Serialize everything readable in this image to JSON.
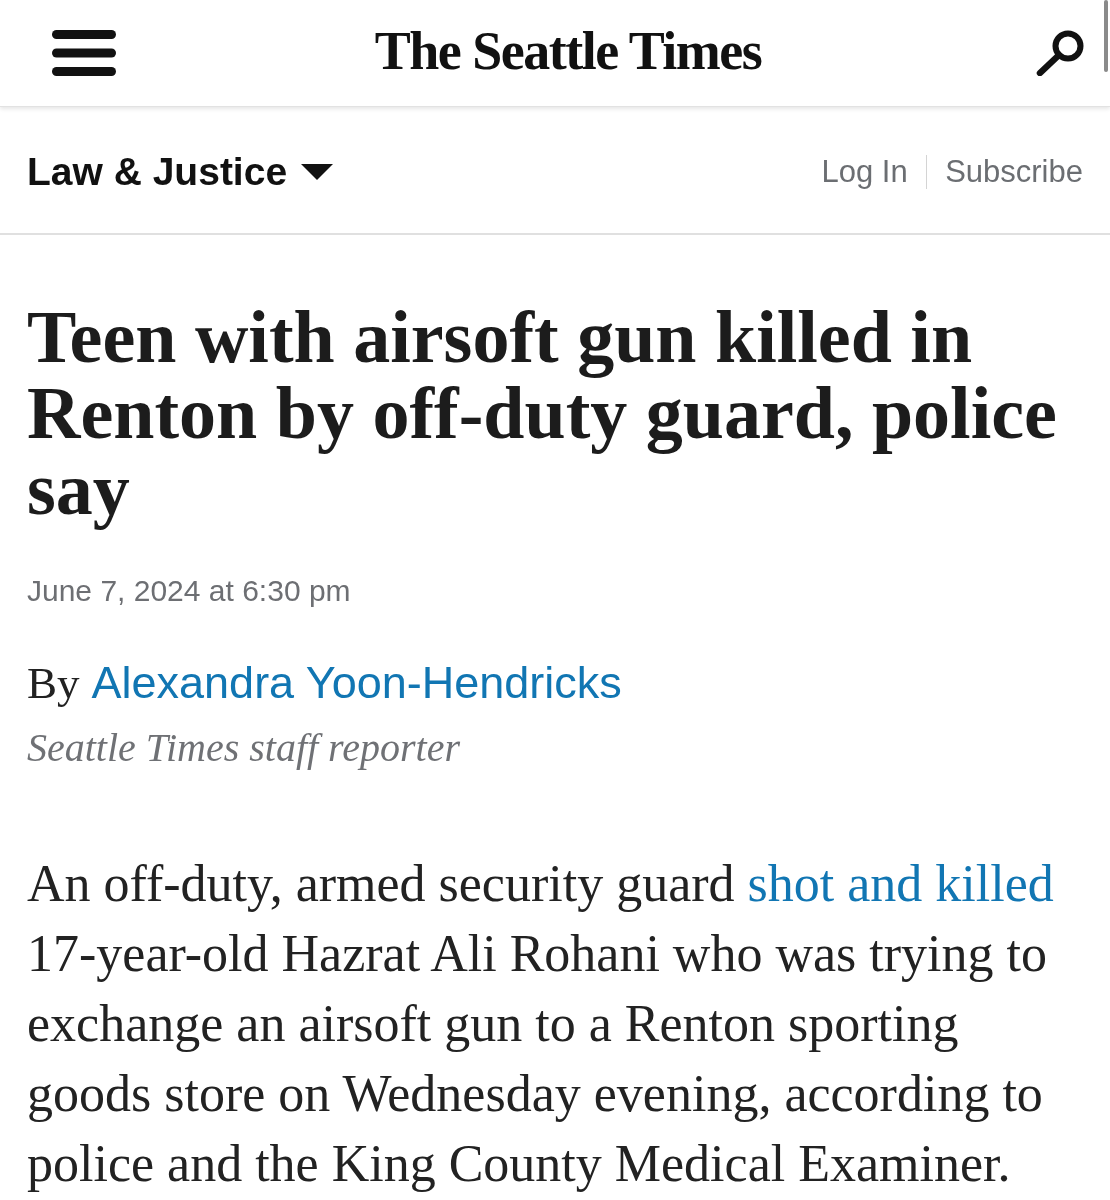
{
  "header": {
    "logo": "The Seattle Times"
  },
  "section_bar": {
    "section": "Law & Justice",
    "links": [
      "Log In",
      "Subscribe"
    ]
  },
  "article": {
    "headline": "Teen with airsoft gun killed in Renton by off-duty guard, police say",
    "timestamp": "June 7, 2024 at 6:30 pm",
    "byline": {
      "prefix": "By",
      "author": "Alexandra Yoon-Hendricks",
      "role": "Seattle Times staff reporter"
    },
    "paragraphs": [
      {
        "segments": [
          {
            "kind": "text",
            "text": "An off-duty, armed security guard "
          },
          {
            "kind": "link",
            "text": "shot and killed"
          },
          {
            "kind": "text",
            "text": " 17-year-old Hazrat Ali Rohani who was trying to exchange an airsoft gun to a Renton sporting goods store on Wednesday evening, according to police and the King County Medical Examiner."
          }
        ]
      }
    ]
  }
}
